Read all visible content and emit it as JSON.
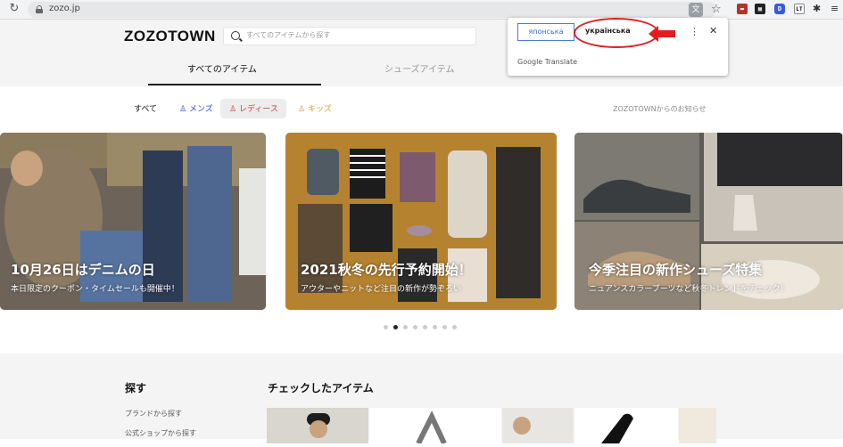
{
  "browser": {
    "url": "zozo.jp",
    "translate_icon": "translate-icon",
    "bookmark_icon": "star-icon",
    "extensions": [
      "red-extension",
      "box-extension",
      "D",
      "LT",
      "puzzle-icon",
      "queue-icon"
    ]
  },
  "translate_popup": {
    "source_lang": "японська",
    "target_lang": "українська",
    "provider": "Google Translate",
    "menu_icon": "kebab-icon",
    "close_icon": "close-icon"
  },
  "header": {
    "logo": "ZOZOTOWN",
    "search_placeholder": "すべてのアイテムから探す",
    "tabs": [
      "すべてのアイテム",
      "シューズアイテム"
    ]
  },
  "categories": {
    "items": [
      "すべて",
      "メンズ",
      "レディース",
      "キッズ"
    ],
    "notice": "ZOZOTOWNからのお知らせ"
  },
  "banners": [
    {
      "title": "10月26日はデニムの日",
      "subtitle": "本日限定のクーポン・タイムセールも開催中！"
    },
    {
      "title": "2021秋冬の先行予約開始！",
      "subtitle": "アウターやニットなど注目の新作が勢ぞろい"
    },
    {
      "title": "今季注目の新作シューズ特集",
      "subtitle": "ニュアンスカラーブーツなど秋冬トレンドをチェック！"
    }
  ],
  "carousel": {
    "count": 8,
    "active_index": 1
  },
  "lower": {
    "find_title": "探す",
    "find_links": [
      "ブランドから探す",
      "公式ショップから探す"
    ],
    "checked_title": "チェックしたアイテム"
  },
  "colors": {
    "accent_blue": "#3a6ed0",
    "annotation_red": "#e01e1e",
    "men": "#1e4bd0",
    "women": "#c64040",
    "kids": "#d6a12a"
  }
}
